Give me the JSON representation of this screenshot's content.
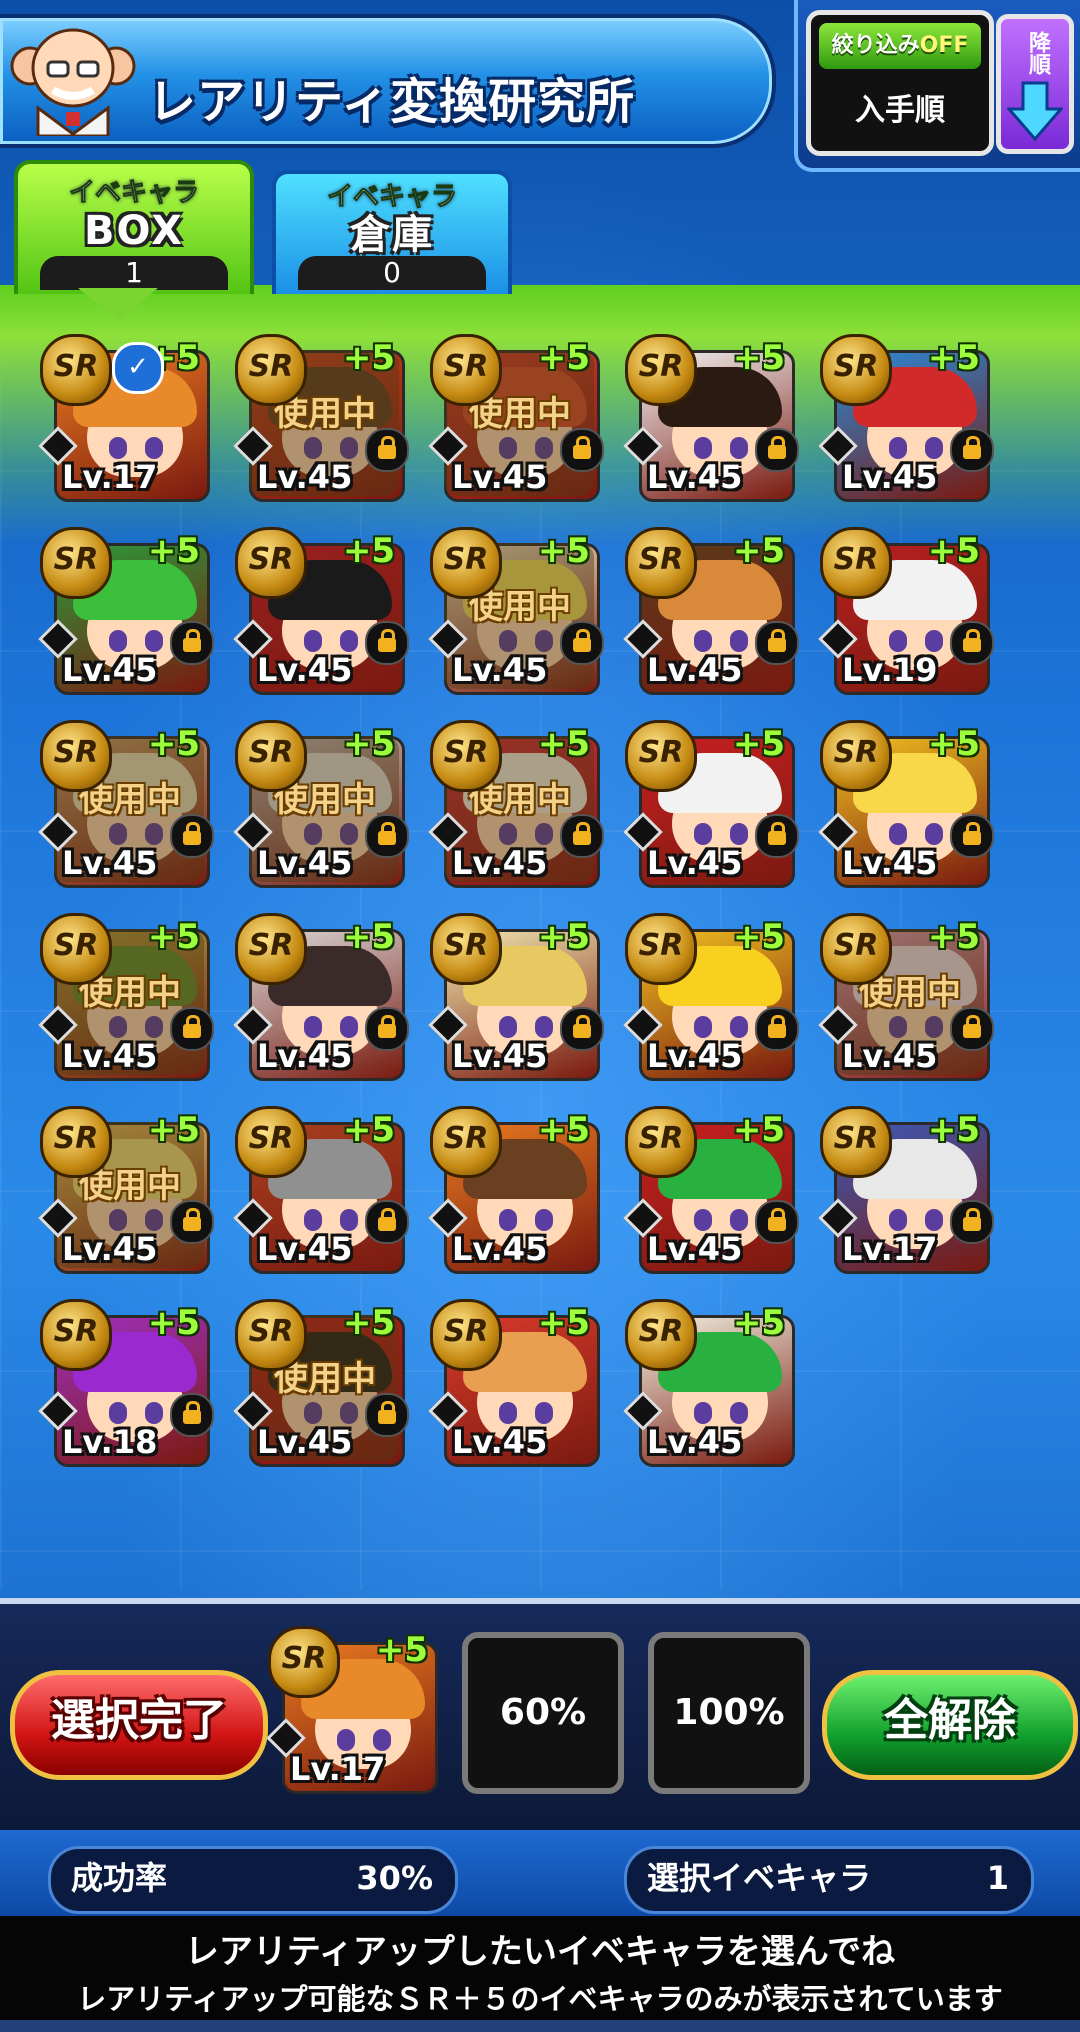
{
  "header": {
    "title": "レアリティ変換研究所",
    "mascot_icon": "professor-mascot-icon"
  },
  "filter": {
    "status_label": "絞り込み",
    "status_value": "OFF",
    "order_label": "入手順"
  },
  "sort": {
    "label": "降順",
    "arrow_icon": "down-arrow-icon"
  },
  "tabs": [
    {
      "small": "イベキャラ",
      "big": "BOX",
      "count": "1"
    },
    {
      "small": "イベキャラ",
      "big": "倉庫",
      "count": "0"
    }
  ],
  "grid": {
    "rarity_label": "SR",
    "plus_label": "+5",
    "in_use_label": "使用中",
    "cards": [
      {
        "lv": "Lv.17",
        "in_use": false,
        "selected": true,
        "locked": false,
        "hair": "#e8892a",
        "bg": "#e97a20"
      },
      {
        "lv": "Lv.45",
        "in_use": true,
        "locked": true,
        "hair": "#5a3a22",
        "bg": "#c8401e"
      },
      {
        "lv": "Lv.45",
        "in_use": true,
        "locked": true,
        "hair": "#d8492a",
        "bg": "#d83a2a"
      },
      {
        "lv": "Lv.45",
        "in_use": false,
        "locked": true,
        "hair": "#2a1a12",
        "bg": "#f2f2f2"
      },
      {
        "lv": "Lv.45",
        "in_use": false,
        "locked": true,
        "hair": "#d22a2a",
        "bg": "#2a8ad8"
      },
      {
        "lv": "Lv.45",
        "in_use": false,
        "locked": true,
        "hair": "#3cbf3c",
        "bg": "#2a9a3a"
      },
      {
        "lv": "Lv.45",
        "in_use": false,
        "locked": true,
        "hair": "#1a1a1a",
        "bg": "#9a2020"
      },
      {
        "lv": "Lv.45",
        "in_use": true,
        "locked": true,
        "hair": "#f0e060",
        "bg": "#f0e8c8"
      },
      {
        "lv": "Lv.45",
        "in_use": false,
        "locked": true,
        "hair": "#d88a3a",
        "bg": "#5a3a1a"
      },
      {
        "lv": "Lv.19",
        "in_use": false,
        "locked": true,
        "hair": "#f2f2f2",
        "bg": "#b82020"
      },
      {
        "lv": "Lv.45",
        "in_use": true,
        "locked": true,
        "hair": "#e8e0c0",
        "bg": "#c8a070"
      },
      {
        "lv": "Lv.45",
        "in_use": true,
        "locked": true,
        "hair": "#e0e0e0",
        "bg": "#c0c0c0"
      },
      {
        "lv": "Lv.45",
        "in_use": true,
        "locked": true,
        "hair": "#f4f0e8",
        "bg": "#d82a3a"
      },
      {
        "lv": "Lv.45",
        "in_use": false,
        "locked": true,
        "hair": "#f2f2f2",
        "bg": "#c82020"
      },
      {
        "lv": "Lv.45",
        "in_use": false,
        "locked": true,
        "hair": "#f8d848",
        "bg": "#f0c020"
      },
      {
        "lv": "Lv.45",
        "in_use": true,
        "locked": true,
        "hair": "#5a8a2a",
        "bg": "#b0a040"
      },
      {
        "lv": "Lv.45",
        "in_use": false,
        "locked": true,
        "hair": "#3a2a2a",
        "bg": "#d8d8d8"
      },
      {
        "lv": "Lv.45",
        "in_use": false,
        "locked": true,
        "hair": "#e8c860",
        "bg": "#f0e8b0"
      },
      {
        "lv": "Lv.45",
        "in_use": false,
        "locked": true,
        "hair": "#f8d020",
        "bg": "#f0c020"
      },
      {
        "lv": "Lv.45",
        "in_use": true,
        "locked": true,
        "hair": "#f0e0f0",
        "bg": "#e0a0c0"
      },
      {
        "lv": "Lv.45",
        "in_use": true,
        "locked": true,
        "hair": "#f0e080",
        "bg": "#e8c860"
      },
      {
        "lv": "Lv.45",
        "in_use": false,
        "locked": true,
        "hair": "#909090",
        "bg": "#a8401e"
      },
      {
        "lv": "Lv.45",
        "in_use": false,
        "locked": false,
        "hair": "#6a4020",
        "bg": "#e87a20"
      },
      {
        "lv": "Lv.45",
        "in_use": false,
        "locked": true,
        "hair": "#28b040",
        "bg": "#c82020"
      },
      {
        "lv": "Lv.17",
        "in_use": false,
        "locked": true,
        "hair": "#e8e8e8",
        "bg": "#3a5ab8"
      },
      {
        "lv": "Lv.18",
        "in_use": false,
        "locked": true,
        "hair": "#9a2ad0",
        "bg": "#a030c0"
      },
      {
        "lv": "Lv.45",
        "in_use": true,
        "locked": true,
        "hair": "#1a1a1a",
        "bg": "#c01a1a"
      },
      {
        "lv": "Lv.45",
        "in_use": false,
        "locked": false,
        "hair": "#e8a050",
        "bg": "#d83a2a"
      },
      {
        "lv": "Lv.45",
        "in_use": false,
        "locked": false,
        "hair": "#28b040",
        "bg": "#f0f0e0"
      }
    ]
  },
  "selection": {
    "complete_button": "選択完了",
    "clear_button": "全解除",
    "selected_card": {
      "lv": "Lv.17",
      "hair": "#e8892a",
      "bg": "#e97a20"
    },
    "slot_1": "60%",
    "slot_2": "100%"
  },
  "stats": {
    "success_label": "成功率",
    "success_value": "30%",
    "selected_label": "選択イベキャラ",
    "selected_value": "1"
  },
  "message": {
    "line1": "レアリティアップしたいイベキャラを選んでね",
    "line2": "レアリティアップ可能なＳＲ＋５のイベキャラのみが表示されています"
  }
}
